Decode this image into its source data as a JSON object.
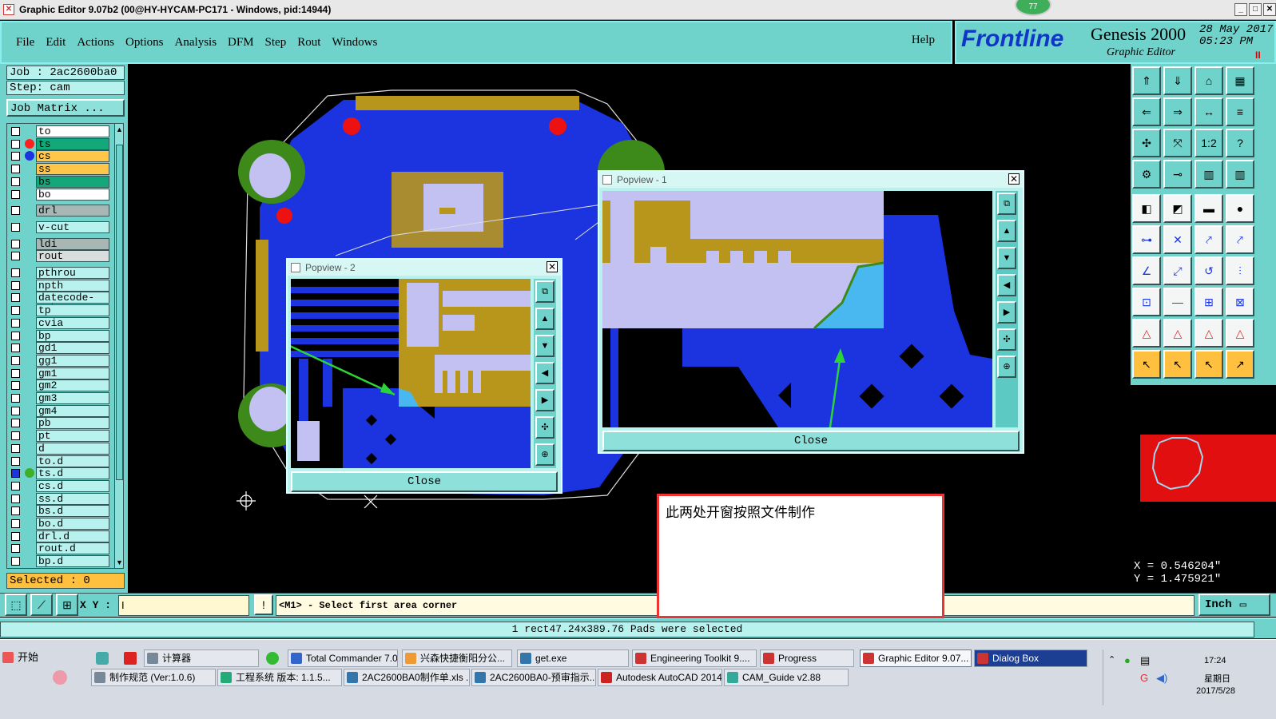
{
  "titlebar": {
    "text": "Graphic Editor 9.07b2 (00@HY-HYCAM-PC171 - Windows, pid:14944)",
    "badge": "77"
  },
  "menu": {
    "items": [
      "File",
      "Edit",
      "Actions",
      "Options",
      "Analysis",
      "DFM",
      "Step",
      "Rout",
      "Windows"
    ],
    "help": "Help"
  },
  "brand": {
    "logo": "Frontline",
    "product": "Genesis 2000",
    "subtitle": "Graphic Editor",
    "date": "28 May 2017",
    "time": "05:23 PM",
    "pause": "II"
  },
  "job": {
    "job": "Job : 2ac2600ba0",
    "step": "Step: cam",
    "matrix": "Job Matrix ..."
  },
  "layers": [
    {
      "name": "to",
      "color": "#ffffff",
      "dot": ""
    },
    {
      "name": "ts",
      "color": "#13a77a",
      "dot": "#ff2020"
    },
    {
      "name": "cs",
      "color": "#ffc64a",
      "dot": "#1b34e0"
    },
    {
      "name": "ss",
      "color": "#ffc64a",
      "dot": ""
    },
    {
      "name": "bs",
      "color": "#13a77a",
      "dot": ""
    },
    {
      "name": "bo",
      "color": "#ffffff",
      "dot": ""
    },
    {
      "name": "drl",
      "color": "#a8b6b5",
      "dot": ""
    },
    {
      "name": "v-cut",
      "color": "#b7f2ee",
      "dot": ""
    },
    {
      "name": "ldi",
      "color": "#a8b6b5",
      "dot": ""
    },
    {
      "name": "rout",
      "color": "#d8dede",
      "dot": ""
    },
    {
      "name": "pthrou",
      "color": "#b7f2ee",
      "dot": ""
    },
    {
      "name": "npth",
      "color": "#b7f2ee",
      "dot": ""
    },
    {
      "name": "datecode-pth",
      "color": "#b7f2ee",
      "dot": ""
    },
    {
      "name": "tp",
      "color": "#b7f2ee",
      "dot": ""
    },
    {
      "name": "cvia",
      "color": "#b7f2ee",
      "dot": ""
    },
    {
      "name": "bp",
      "color": "#b7f2ee",
      "dot": ""
    },
    {
      "name": "gd1",
      "color": "#b7f2ee",
      "dot": ""
    },
    {
      "name": "gg1",
      "color": "#b7f2ee",
      "dot": ""
    },
    {
      "name": "gm1",
      "color": "#b7f2ee",
      "dot": ""
    },
    {
      "name": "gm2",
      "color": "#b7f2ee",
      "dot": ""
    },
    {
      "name": "gm3",
      "color": "#b7f2ee",
      "dot": ""
    },
    {
      "name": "gm4",
      "color": "#b7f2ee",
      "dot": ""
    },
    {
      "name": "pb",
      "color": "#b7f2ee",
      "dot": ""
    },
    {
      "name": "pt",
      "color": "#b7f2ee",
      "dot": ""
    },
    {
      "name": "d",
      "color": "#b7f2ee",
      "dot": ""
    },
    {
      "name": "to.d",
      "color": "#b7f2ee",
      "dot": ""
    },
    {
      "name": "ts.d",
      "color": "#b7f2ee",
      "dot": "#3fae2a"
    },
    {
      "name": "cs.d",
      "color": "#b7f2ee",
      "dot": ""
    },
    {
      "name": "ss.d",
      "color": "#b7f2ee",
      "dot": ""
    },
    {
      "name": "bs.d",
      "color": "#b7f2ee",
      "dot": ""
    },
    {
      "name": "bo.d",
      "color": "#b7f2ee",
      "dot": ""
    },
    {
      "name": "drl.d",
      "color": "#b7f2ee",
      "dot": ""
    },
    {
      "name": "rout.d",
      "color": "#b7f2ee",
      "dot": ""
    },
    {
      "name": "bp.d",
      "color": "#b7f2ee",
      "dot": ""
    }
  ],
  "selected": "Selected : 0",
  "popview2": {
    "title": "Popview - 2",
    "close": "Close"
  },
  "popview1": {
    "title": "Popview - 1",
    "close": "Close"
  },
  "note": {
    "text": "此两处开窗按照文件制作"
  },
  "coords": {
    "x": "X = 0.546204\"",
    "y": "Y = 1.475921\""
  },
  "bottombar": {
    "xy_label": "X Y :",
    "xy_value": "I",
    "prompt": "<M1> - Select first area corner",
    "units": "Inch"
  },
  "status": "1 rect47.24x389.76 Pads were selected",
  "taskbar": {
    "start": "开始",
    "row1": [
      "计算器",
      "Total Commander 7.0...",
      "兴森快捷衡阳分公...",
      "get.exe",
      "Engineering Toolkit 9....",
      "Progress",
      "Graphic Editor 9.07...",
      "Dialog Box"
    ],
    "row2": [
      "制作规范 (Ver:1.0.6)",
      "工程系统  版本: 1.1.5...",
      "2AC2600BA0制作单.xls ...",
      "2AC2600BA0-预审指示....",
      "Autodesk AutoCAD 2014...",
      "CAM_Guide v2.88"
    ],
    "clock": "17:24",
    "weekday": "星期日",
    "date": "2017/5/28"
  },
  "colors": {
    "panel": "#6fd3cc",
    "copper": "#1b34e0",
    "gold": "#b8961c",
    "pad": "#c3c0f2",
    "cyan": "#4ab8f0"
  }
}
